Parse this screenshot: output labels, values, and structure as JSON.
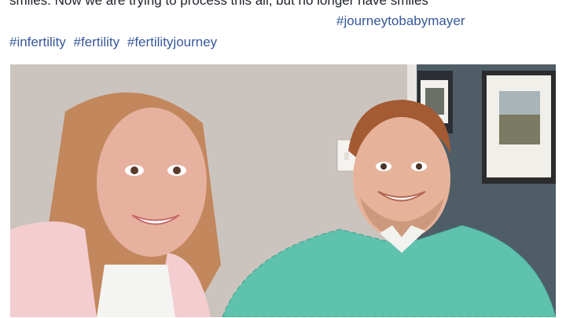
{
  "post": {
    "text_line_cut": "smiles. Now we are trying to process this all, but no longer have smiles",
    "hashtag_line_1": "#journeytobabymayer",
    "hashtags": [
      "#infertility",
      "#fertility",
      "#fertilityjourney"
    ]
  },
  "photo": {
    "subject": "photo-selfie-couple"
  }
}
